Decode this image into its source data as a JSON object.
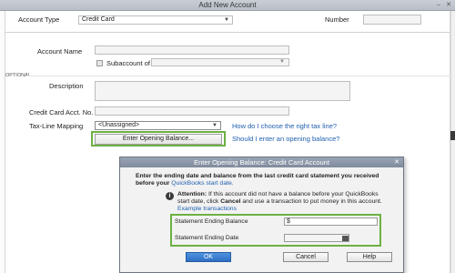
{
  "main_window": {
    "title": "Add New Account",
    "controls": {
      "minimize": "–",
      "close": "✕"
    },
    "account_type": {
      "label": "Account Type",
      "value": "Credit Card"
    },
    "number": {
      "label": "Number",
      "value": ""
    },
    "account_name": {
      "label": "Account Name",
      "value": ""
    },
    "subaccount": {
      "label": "Subaccount of",
      "value": ""
    },
    "optional_label": "OPTIONAL",
    "description": {
      "label": "Description",
      "value": ""
    },
    "card_acct_no": {
      "label": "Credit Card Acct. No.",
      "value": ""
    },
    "tax_line": {
      "label": "Tax-Line Mapping",
      "value": "<Unassigned>"
    },
    "tax_link": "How do I choose the right tax line?",
    "opening_balance_button": "Enter Opening Balance...",
    "opening_balance_link": "Should I enter an opening balance?"
  },
  "sub_dialog": {
    "title": "Enter Opening Balance: Credit Card Account",
    "close": "✕",
    "intro_line1": "Enter the ending date and balance from the last credit card statement you received",
    "intro_line2_prefix": "before your ",
    "intro_link": "QuickBooks start date.",
    "attention_label": "Attention:",
    "attention_line1": "If this account did not have a balance before your QuickBooks",
    "attention_line2_a": "start date, click ",
    "attention_cancel": "Cancel",
    "attention_line2_b": " and use a transaction to put money in this account.",
    "example_link": "Example transactions",
    "statement_balance": {
      "label": "Statement Ending Balance",
      "value": "$"
    },
    "statement_date": {
      "label": "Statement Ending Date",
      "value": ""
    },
    "buttons": {
      "ok": "OK",
      "cancel": "Cancel",
      "help": "Help"
    }
  }
}
